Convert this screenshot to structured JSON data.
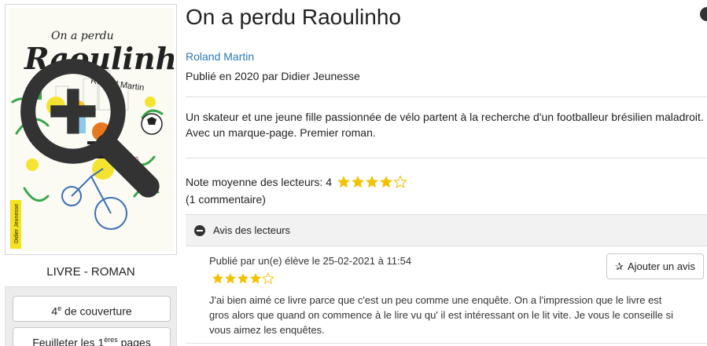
{
  "book": {
    "title": "On a perdu Raoulinho",
    "author": "Roland Martin",
    "published": "Publié en 2020 par Didier Jeunesse",
    "summary": "Un skateur et une jeune fille passionnée de vélo partent à la recherche d'un footballeur brésilien maladroit. Avec un marque-page. Premier roman.",
    "type_label": "LIVRE - ROMAN"
  },
  "cover": {
    "title_top": "On a perdu",
    "title_main": "Raoulinho",
    "author": "Roland Martin",
    "publisher": "Didier Jeunesse"
  },
  "side_buttons": {
    "back_cover_pre": "4",
    "back_cover_sup": "e",
    "back_cover_post": " de couverture",
    "browse_pre": "Feuilleter les 1",
    "browse_sup": "ères",
    "browse_post": " pages"
  },
  "rating": {
    "label": "Note moyenne des lecteurs: 4",
    "value": 4,
    "max": 5,
    "count_text": "(1 commentaire)",
    "star_color": "#f2c200"
  },
  "reviews_section": {
    "header": "Avis des lecteurs",
    "add_button": "Ajouter un avis"
  },
  "review": {
    "meta": "Publié par un(e) élève le 25-02-2021 à 11:54",
    "stars": 4,
    "text": "J'ai bien aimé ce livre parce que c'est un peu comme une enquête. On a l'impression que le livre est gros alors que quand on commence à le lire vu qu' il est intéressant on le lit vite. Je vous le conseille si vous aimez les enquêtes."
  },
  "colors": {
    "link": "#2a7ab8",
    "star": "#f2c200"
  }
}
